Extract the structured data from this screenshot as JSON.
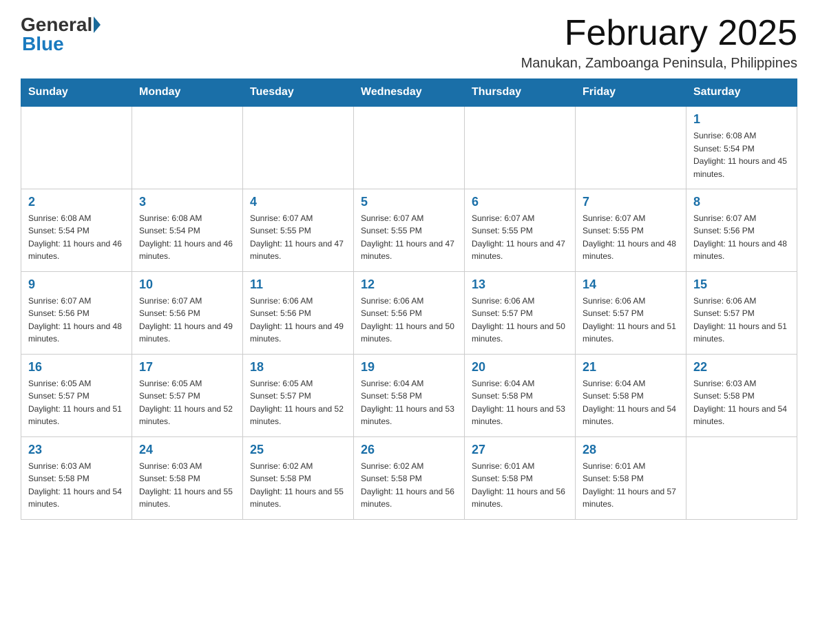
{
  "header": {
    "logo_general": "General",
    "logo_blue": "Blue",
    "month_title": "February 2025",
    "location": "Manukan, Zamboanga Peninsula, Philippines"
  },
  "weekdays": [
    "Sunday",
    "Monday",
    "Tuesday",
    "Wednesday",
    "Thursday",
    "Friday",
    "Saturday"
  ],
  "weeks": [
    [
      {
        "day": "",
        "sunrise": "",
        "sunset": "",
        "daylight": ""
      },
      {
        "day": "",
        "sunrise": "",
        "sunset": "",
        "daylight": ""
      },
      {
        "day": "",
        "sunrise": "",
        "sunset": "",
        "daylight": ""
      },
      {
        "day": "",
        "sunrise": "",
        "sunset": "",
        "daylight": ""
      },
      {
        "day": "",
        "sunrise": "",
        "sunset": "",
        "daylight": ""
      },
      {
        "day": "",
        "sunrise": "",
        "sunset": "",
        "daylight": ""
      },
      {
        "day": "1",
        "sunrise": "Sunrise: 6:08 AM",
        "sunset": "Sunset: 5:54 PM",
        "daylight": "Daylight: 11 hours and 45 minutes."
      }
    ],
    [
      {
        "day": "2",
        "sunrise": "Sunrise: 6:08 AM",
        "sunset": "Sunset: 5:54 PM",
        "daylight": "Daylight: 11 hours and 46 minutes."
      },
      {
        "day": "3",
        "sunrise": "Sunrise: 6:08 AM",
        "sunset": "Sunset: 5:54 PM",
        "daylight": "Daylight: 11 hours and 46 minutes."
      },
      {
        "day": "4",
        "sunrise": "Sunrise: 6:07 AM",
        "sunset": "Sunset: 5:55 PM",
        "daylight": "Daylight: 11 hours and 47 minutes."
      },
      {
        "day": "5",
        "sunrise": "Sunrise: 6:07 AM",
        "sunset": "Sunset: 5:55 PM",
        "daylight": "Daylight: 11 hours and 47 minutes."
      },
      {
        "day": "6",
        "sunrise": "Sunrise: 6:07 AM",
        "sunset": "Sunset: 5:55 PM",
        "daylight": "Daylight: 11 hours and 47 minutes."
      },
      {
        "day": "7",
        "sunrise": "Sunrise: 6:07 AM",
        "sunset": "Sunset: 5:55 PM",
        "daylight": "Daylight: 11 hours and 48 minutes."
      },
      {
        "day": "8",
        "sunrise": "Sunrise: 6:07 AM",
        "sunset": "Sunset: 5:56 PM",
        "daylight": "Daylight: 11 hours and 48 minutes."
      }
    ],
    [
      {
        "day": "9",
        "sunrise": "Sunrise: 6:07 AM",
        "sunset": "Sunset: 5:56 PM",
        "daylight": "Daylight: 11 hours and 48 minutes."
      },
      {
        "day": "10",
        "sunrise": "Sunrise: 6:07 AM",
        "sunset": "Sunset: 5:56 PM",
        "daylight": "Daylight: 11 hours and 49 minutes."
      },
      {
        "day": "11",
        "sunrise": "Sunrise: 6:06 AM",
        "sunset": "Sunset: 5:56 PM",
        "daylight": "Daylight: 11 hours and 49 minutes."
      },
      {
        "day": "12",
        "sunrise": "Sunrise: 6:06 AM",
        "sunset": "Sunset: 5:56 PM",
        "daylight": "Daylight: 11 hours and 50 minutes."
      },
      {
        "day": "13",
        "sunrise": "Sunrise: 6:06 AM",
        "sunset": "Sunset: 5:57 PM",
        "daylight": "Daylight: 11 hours and 50 minutes."
      },
      {
        "day": "14",
        "sunrise": "Sunrise: 6:06 AM",
        "sunset": "Sunset: 5:57 PM",
        "daylight": "Daylight: 11 hours and 51 minutes."
      },
      {
        "day": "15",
        "sunrise": "Sunrise: 6:06 AM",
        "sunset": "Sunset: 5:57 PM",
        "daylight": "Daylight: 11 hours and 51 minutes."
      }
    ],
    [
      {
        "day": "16",
        "sunrise": "Sunrise: 6:05 AM",
        "sunset": "Sunset: 5:57 PM",
        "daylight": "Daylight: 11 hours and 51 minutes."
      },
      {
        "day": "17",
        "sunrise": "Sunrise: 6:05 AM",
        "sunset": "Sunset: 5:57 PM",
        "daylight": "Daylight: 11 hours and 52 minutes."
      },
      {
        "day": "18",
        "sunrise": "Sunrise: 6:05 AM",
        "sunset": "Sunset: 5:57 PM",
        "daylight": "Daylight: 11 hours and 52 minutes."
      },
      {
        "day": "19",
        "sunrise": "Sunrise: 6:04 AM",
        "sunset": "Sunset: 5:58 PM",
        "daylight": "Daylight: 11 hours and 53 minutes."
      },
      {
        "day": "20",
        "sunrise": "Sunrise: 6:04 AM",
        "sunset": "Sunset: 5:58 PM",
        "daylight": "Daylight: 11 hours and 53 minutes."
      },
      {
        "day": "21",
        "sunrise": "Sunrise: 6:04 AM",
        "sunset": "Sunset: 5:58 PM",
        "daylight": "Daylight: 11 hours and 54 minutes."
      },
      {
        "day": "22",
        "sunrise": "Sunrise: 6:03 AM",
        "sunset": "Sunset: 5:58 PM",
        "daylight": "Daylight: 11 hours and 54 minutes."
      }
    ],
    [
      {
        "day": "23",
        "sunrise": "Sunrise: 6:03 AM",
        "sunset": "Sunset: 5:58 PM",
        "daylight": "Daylight: 11 hours and 54 minutes."
      },
      {
        "day": "24",
        "sunrise": "Sunrise: 6:03 AM",
        "sunset": "Sunset: 5:58 PM",
        "daylight": "Daylight: 11 hours and 55 minutes."
      },
      {
        "day": "25",
        "sunrise": "Sunrise: 6:02 AM",
        "sunset": "Sunset: 5:58 PM",
        "daylight": "Daylight: 11 hours and 55 minutes."
      },
      {
        "day": "26",
        "sunrise": "Sunrise: 6:02 AM",
        "sunset": "Sunset: 5:58 PM",
        "daylight": "Daylight: 11 hours and 56 minutes."
      },
      {
        "day": "27",
        "sunrise": "Sunrise: 6:01 AM",
        "sunset": "Sunset: 5:58 PM",
        "daylight": "Daylight: 11 hours and 56 minutes."
      },
      {
        "day": "28",
        "sunrise": "Sunrise: 6:01 AM",
        "sunset": "Sunset: 5:58 PM",
        "daylight": "Daylight: 11 hours and 57 minutes."
      },
      {
        "day": "",
        "sunrise": "",
        "sunset": "",
        "daylight": ""
      }
    ]
  ]
}
